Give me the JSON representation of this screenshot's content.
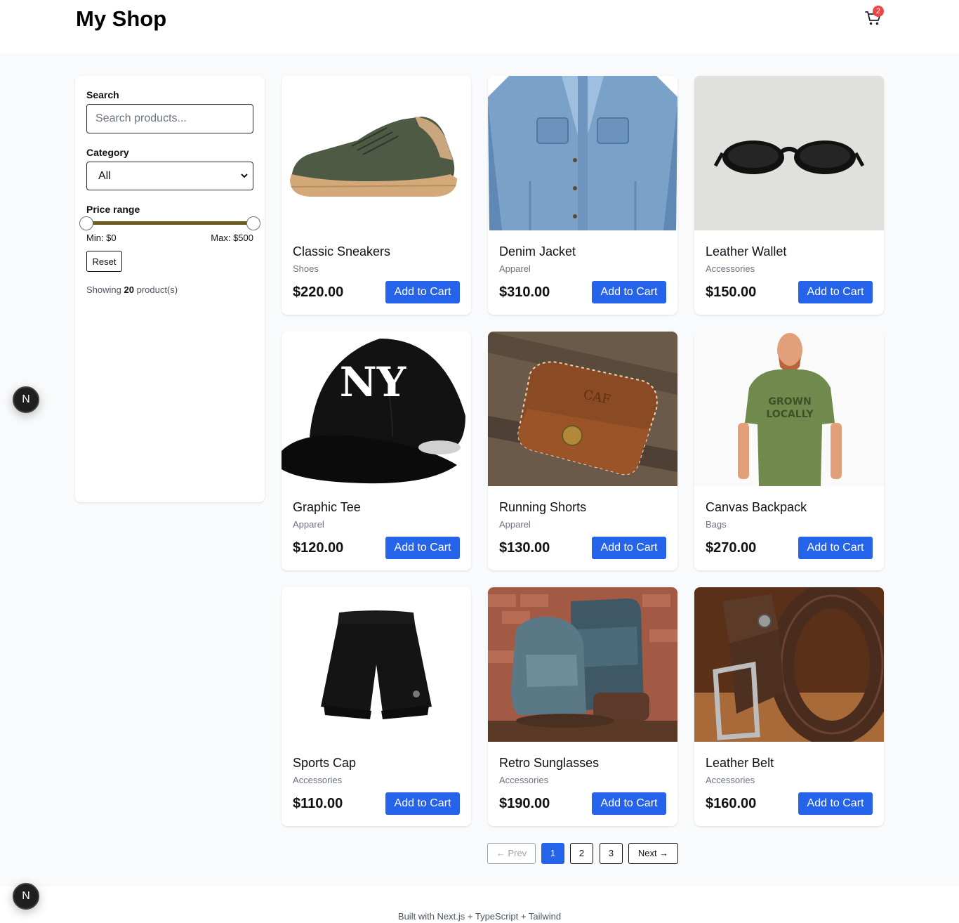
{
  "header": {
    "title": "My Shop",
    "cart_count": "2",
    "cart_icon": "shopping-cart-icon"
  },
  "filters": {
    "search_label": "Search",
    "search_placeholder": "Search products...",
    "search_value": "",
    "category_label": "Category",
    "category_value": "All",
    "price_label": "Price range",
    "price_min_text": "Min: $0",
    "price_max_text": "Max: $500",
    "price_min_value": 0,
    "price_max_value": 500,
    "reset_label": "Reset",
    "showing_prefix": "Showing",
    "showing_count": "20",
    "showing_suffix": "product(s)"
  },
  "products": [
    {
      "name": "Classic Sneakers",
      "category": "Shoes",
      "price": "$220.00",
      "button": "Add to Cart",
      "image": "sneaker-image"
    },
    {
      "name": "Denim Jacket",
      "category": "Apparel",
      "price": "$310.00",
      "button": "Add to Cart",
      "image": "denim-jacket-image"
    },
    {
      "name": "Leather Wallet",
      "category": "Accessories",
      "price": "$150.00",
      "button": "Add to Cart",
      "image": "sunglasses-image"
    },
    {
      "name": "Graphic Tee",
      "category": "Apparel",
      "price": "$120.00",
      "button": "Add to Cart",
      "image": "baseball-cap-image"
    },
    {
      "name": "Running Shorts",
      "category": "Apparel",
      "price": "$130.00",
      "button": "Add to Cart",
      "image": "leather-wallet-image"
    },
    {
      "name": "Canvas Backpack",
      "category": "Bags",
      "price": "$270.00",
      "button": "Add to Cart",
      "image": "green-tshirt-image"
    },
    {
      "name": "Sports Cap",
      "category": "Accessories",
      "price": "$110.00",
      "button": "Add to Cart",
      "image": "running-shorts-image"
    },
    {
      "name": "Retro Sunglasses",
      "category": "Accessories",
      "price": "$190.00",
      "button": "Add to Cart",
      "image": "backpacks-image"
    },
    {
      "name": "Leather Belt",
      "category": "Accessories",
      "price": "$160.00",
      "button": "Add to Cart",
      "image": "leather-belt-image"
    }
  ],
  "pagination": {
    "prev": "← Prev",
    "pages": [
      "1",
      "2",
      "3"
    ],
    "current": "1",
    "next": "Next →"
  },
  "footer": {
    "text": "Built with Next.js + TypeScript + Tailwind"
  },
  "dev_badge": "N",
  "colors": {
    "accent": "#2563eb",
    "badge": "#ef4444",
    "range_track": "#6b5a1a"
  }
}
